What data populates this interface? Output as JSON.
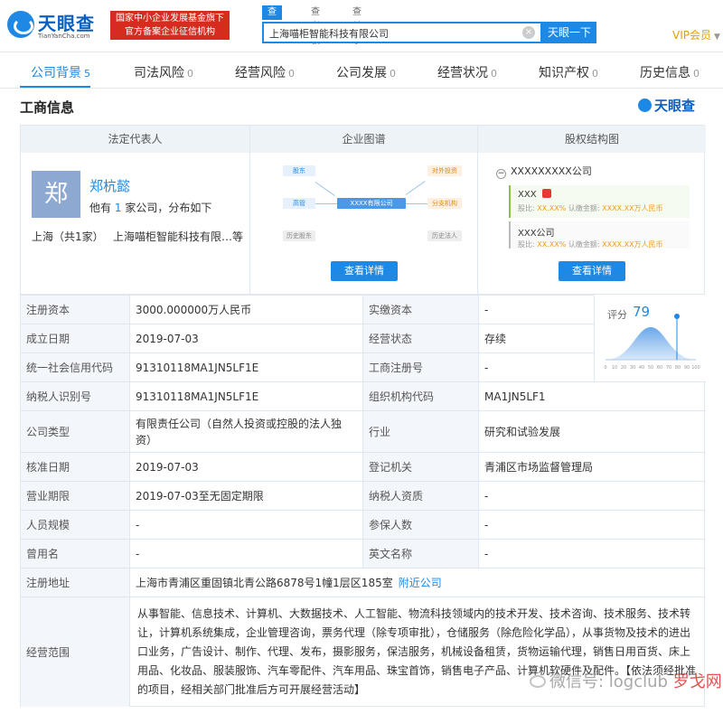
{
  "header": {
    "logo_cn": "天眼查",
    "logo_en": "TianYanCha.com",
    "gov_line1": "国家中小企业发展基金旗下",
    "gov_line2": "官方备案企业征信机构",
    "search_tabs": [
      "查公司",
      "查老板",
      "查关系"
    ],
    "search_value": "上海喵柜智能科技有限公司",
    "search_button": "天眼一下",
    "vip": "VIP会员"
  },
  "nav": [
    {
      "label": "公司背景",
      "count": "5"
    },
    {
      "label": "司法风险",
      "count": "0"
    },
    {
      "label": "经营风险",
      "count": "0"
    },
    {
      "label": "公司发展",
      "count": "0"
    },
    {
      "label": "经营状况",
      "count": "0"
    },
    {
      "label": "知识产权",
      "count": "0"
    },
    {
      "label": "历史信息",
      "count": "0"
    }
  ],
  "section": {
    "title": "工商信息",
    "brand": "天眼查"
  },
  "panels": {
    "legal_rep": {
      "head": "法定代表人",
      "avatar": "郑",
      "name": "郑杭懿",
      "desc_pre": "他有",
      "desc_num": "1",
      "desc_post": "家公司，分布如下",
      "location": "上海（共1家）",
      "company": "上海喵柜智能科技有限…等"
    },
    "graph": {
      "head": "企业图谱",
      "center": "XXXX有限公司",
      "left_nodes": [
        "股东",
        "高管",
        "历史股东"
      ],
      "right_nodes": [
        "对外投资",
        "分支机构",
        "历史法人"
      ],
      "button": "查看详情"
    },
    "equity": {
      "head": "股权结构图",
      "company": "XXXXXXXXX公司",
      "holders": [
        {
          "name": "XXX",
          "ratio_label": "股比:",
          "ratio": "XX.XX%",
          "sub_label": "认缴金额:",
          "sub": "XXXX.XX万人民币"
        },
        {
          "name": "XXX公司",
          "ratio_label": "股比:",
          "ratio": "XX.XX%",
          "sub_label": "认缴金额:",
          "sub": "XXXX.XX万人民币"
        }
      ],
      "button": "查看详情"
    }
  },
  "score": {
    "label": "评分",
    "value": "79",
    "ticks": [
      "0",
      "10",
      "20",
      "30",
      "40",
      "50",
      "60",
      "70",
      "80",
      "90",
      "100"
    ]
  },
  "info": [
    {
      "l1": "注册资本",
      "v1": "3000.000000万人民币",
      "l2": "实缴资本",
      "v2": "-"
    },
    {
      "l1": "成立日期",
      "v1": "2019-07-03",
      "l2": "经营状态",
      "v2": "存续"
    },
    {
      "l1": "统一社会信用代码",
      "v1": "91310118MA1JN5LF1E",
      "l2": "工商注册号",
      "v2": "-"
    },
    {
      "l1": "纳税人识别号",
      "v1": "91310118MA1JN5LF1E",
      "l2": "组织机构代码",
      "v2": "MA1JN5LF1"
    },
    {
      "l1": "公司类型",
      "v1": "有限责任公司（自然人投资或控股的法人独资）",
      "l2": "行业",
      "v2": "研究和试验发展"
    },
    {
      "l1": "核准日期",
      "v1": "2019-07-03",
      "l2": "登记机关",
      "v2": "青浦区市场监督管理局"
    },
    {
      "l1": "营业期限",
      "v1": "2019-07-03至无固定期限",
      "l2": "纳税人资质",
      "v2": "-"
    },
    {
      "l1": "人员规模",
      "v1": "-",
      "l2": "参保人数",
      "v2": "-"
    },
    {
      "l1": "曾用名",
      "v1": "-",
      "l2": "英文名称",
      "v2": "-"
    }
  ],
  "address": {
    "label": "注册地址",
    "value": "上海市青浦区重固镇北青公路6878号1幢1层区185室",
    "link": "附近公司"
  },
  "scope": {
    "label": "经营范围",
    "value": "从事智能、信息技术、计算机、大数据技术、人工智能、物流科技领域内的技术开发、技术咨询、技术服务、技术转让，计算机系统集成，企业管理咨询，票务代理（除专项审批），仓储服务（除危险化学品），从事货物及技术的进出口业务，广告设计、制作、代理、发布，摄影服务，保洁服务，机械设备租赁，货物运输代理，销售日用百货、床上用品、化妆品、服装服饰、汽车零配件、汽车用品、珠宝首饰，销售电子产品、计算机软硬件及配件。【依法须经批准的项目，经相关部门批准后方可开展经营活动】"
  },
  "watermark": {
    "text": "微信号: logclub",
    "brand": "罗戈网"
  },
  "colors": {
    "primary": "#1e88e5",
    "gov_red": "#d62c1f",
    "label_bg": "#f3f6fa",
    "vip": "#e0a100"
  }
}
